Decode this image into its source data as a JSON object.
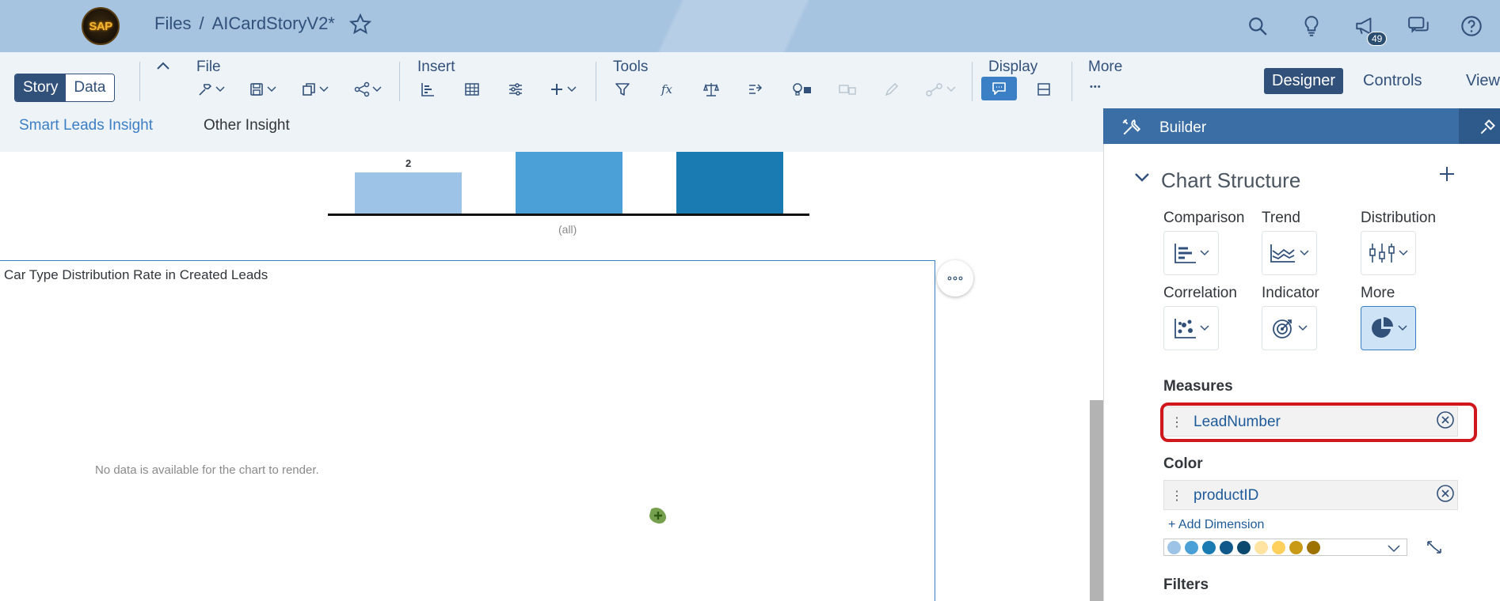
{
  "shell": {
    "breadcrumb_root": "Files",
    "breadcrumb_sep": "/",
    "story_title": "AICardStoryV2*",
    "logo_text": "SAP",
    "notification_count": "49",
    "icons": [
      "menu-icon",
      "star-icon",
      "search-icon",
      "lightbulb-icon",
      "megaphone-icon",
      "chat-icon",
      "help-icon"
    ]
  },
  "toolbar": {
    "mode_story": "Story",
    "mode_data": "Data",
    "groups": {
      "file": "File",
      "insert": "Insert",
      "tools": "Tools",
      "display": "Display",
      "more": "More"
    },
    "more_dots": "•••",
    "view_modes": {
      "designer": "Designer",
      "controls": "Controls",
      "view": "View"
    }
  },
  "pages": {
    "tab1": "Smart Leads Insight",
    "tab2": "Other Insight"
  },
  "top_chart": {
    "bar_label": "2",
    "category_label": "(all)",
    "colors": [
      "#9dc3e6",
      "#4ba0d7",
      "#1a7bb3"
    ]
  },
  "chart_card": {
    "title": "Car Type Distribution Rate in Created Leads",
    "no_data": "No data is available for the chart to render."
  },
  "builder": {
    "title": "Builder",
    "section": "Chart Structure",
    "types": {
      "comparison": "Comparison",
      "trend": "Trend",
      "distribution": "Distribution",
      "correlation": "Correlation",
      "indicator": "Indicator",
      "more": "More"
    },
    "measures_label": "Measures",
    "measure_value": "LeadNumber",
    "color_label": "Color",
    "color_value": "productID",
    "add_dimension": "+ Add Dimension",
    "palette": [
      "#9dc3e6",
      "#4ba0d7",
      "#1a7bb3",
      "#11598a",
      "#0b4a6e",
      "#ffe3a3",
      "#ffd05c",
      "#c99a15",
      "#9e7200"
    ],
    "filters_label": "Filters"
  }
}
